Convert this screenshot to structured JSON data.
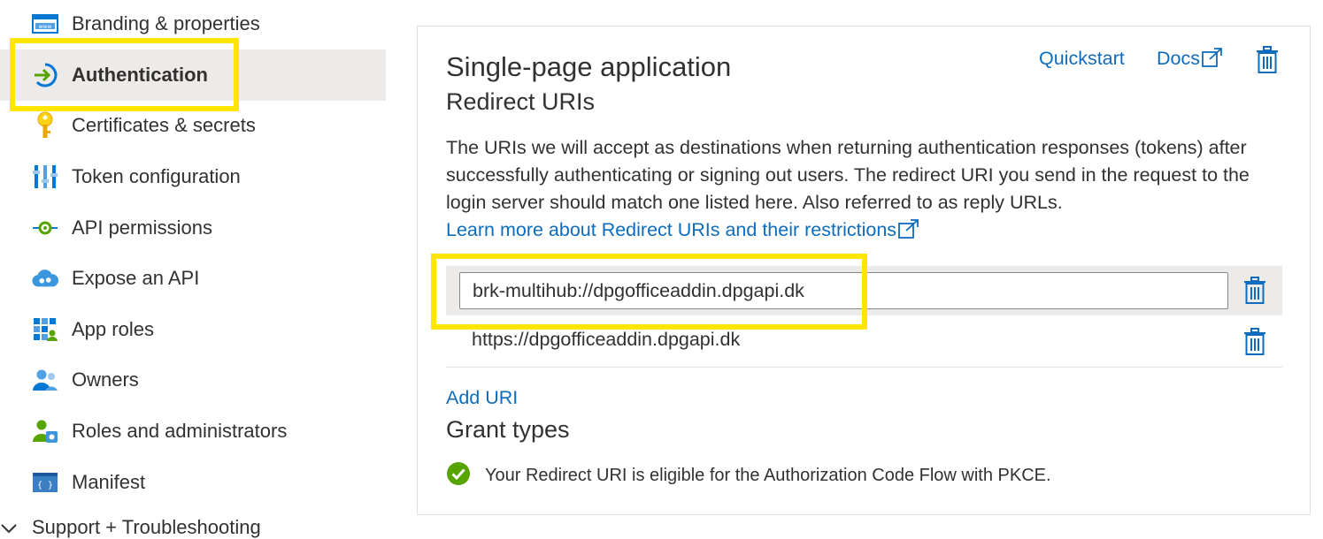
{
  "sidebar": {
    "items": [
      {
        "label": "Branding & properties",
        "icon": "branding-icon"
      },
      {
        "label": "Authentication",
        "icon": "authentication-icon",
        "active": true
      },
      {
        "label": "Certificates & secrets",
        "icon": "key-icon"
      },
      {
        "label": "Token configuration",
        "icon": "token-config-icon"
      },
      {
        "label": "API permissions",
        "icon": "api-permissions-icon"
      },
      {
        "label": "Expose an API",
        "icon": "cloud-icon"
      },
      {
        "label": "App roles",
        "icon": "app-roles-icon"
      },
      {
        "label": "Owners",
        "icon": "owners-icon"
      },
      {
        "label": "Roles and administrators",
        "icon": "roles-admin-icon"
      },
      {
        "label": "Manifest",
        "icon": "manifest-icon"
      }
    ],
    "bottom_group": "Support + Troubleshooting"
  },
  "spa": {
    "title": "Single-page application",
    "subtitle": "Redirect URIs",
    "description": "The URIs we will accept as destinations when returning authentication responses (tokens) after successfully authenticating or signing out users. The redirect URI you send in the request to the login server should match one listed here. Also referred to as reply URLs.",
    "learn_more": "Learn more about Redirect URIs and their restrictions",
    "quickstart": "Quickstart",
    "docs": "Docs",
    "uris": [
      "brk-multihub://dpgofficeaddin.dpgapi.dk",
      "https://dpgofficeaddin.dpgapi.dk"
    ],
    "add_uri": "Add URI",
    "grant_types_title": "Grant types",
    "grant_types_message": "Your Redirect URI is eligible for the Authorization Code Flow with PKCE."
  },
  "colors": {
    "accent": "#0f6cbd",
    "highlight": "#ffe500",
    "success": "#57a300",
    "active_bg": "#edebe9"
  }
}
